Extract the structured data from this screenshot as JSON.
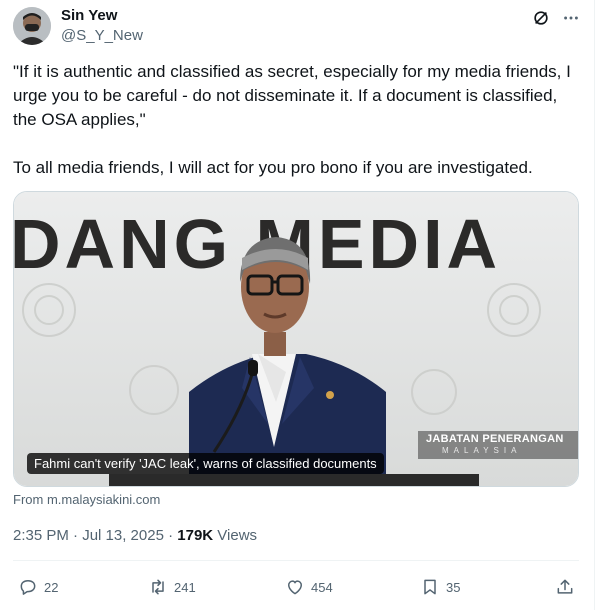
{
  "author": {
    "name": "Sin Yew",
    "handle": "@S_Y_New"
  },
  "icons": {
    "grok": "grok-icon",
    "more": "more-icon",
    "reply": "reply-icon",
    "retweet": "retweet-icon",
    "like": "heart-icon",
    "bookmark": "bookmark-icon",
    "share": "share-icon"
  },
  "tweet": {
    "paragraph_1": "\"If it is authentic and classified as secret, especially for my media friends, I urge you to be careful - do not disseminate it. If a document is classified, the OSA applies,\"",
    "paragraph_2": "To all media friends, I will act for you pro bono if you are investigated."
  },
  "card": {
    "backdrop_text": "DANG MEDIA",
    "caption": "Fahmi can't verify 'JAC leak', warns of classified documents",
    "watermark_line1": "JABATAN PENERANGAN",
    "watermark_line2": "MALAYSIA",
    "source": "From m.malaysiakini.com"
  },
  "meta": {
    "timestamp": "2:35 PM · Jul 13, 2025 ·",
    "views_count": "179K",
    "views_label": "Views"
  },
  "actions": {
    "replies": "22",
    "retweets": "241",
    "likes": "454",
    "bookmarks": "35"
  },
  "colors": {
    "text_primary": "#0f1419",
    "text_secondary": "#536471",
    "border": "#eff3f4"
  }
}
